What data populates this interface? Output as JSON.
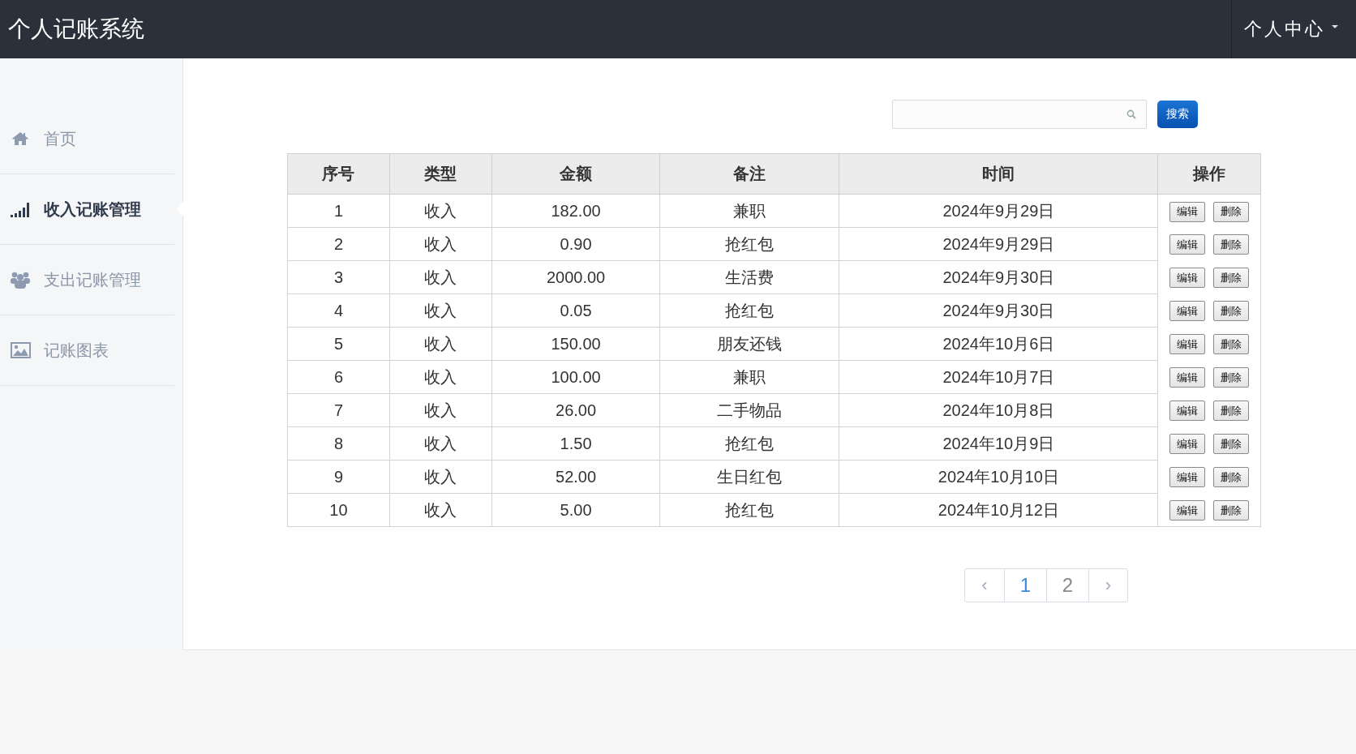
{
  "header": {
    "title": "个人记账系统",
    "user_menu": "个人中心"
  },
  "sidebar": {
    "items": [
      {
        "label": "首页",
        "selected": false
      },
      {
        "label": "收入记账管理",
        "selected": true
      },
      {
        "label": "支出记账管理",
        "selected": false
      },
      {
        "label": "记账图表",
        "selected": false
      }
    ]
  },
  "search": {
    "button": "搜索"
  },
  "table": {
    "columns": [
      "序号",
      "类型",
      "金额",
      "备注",
      "时间",
      "操作"
    ],
    "rows": [
      {
        "cells": [
          "1",
          "收入",
          "182.00",
          "兼职",
          "2024年9月29日"
        ],
        "actions": [
          "编辑",
          "删除"
        ]
      },
      {
        "cells": [
          "2",
          "收入",
          "0.90",
          "抢红包",
          "2024年9月29日"
        ],
        "actions": [
          "编辑",
          "删除"
        ]
      },
      {
        "cells": [
          "3",
          "收入",
          "2000.00",
          "生活费",
          "2024年9月30日"
        ],
        "actions": [
          "编辑",
          "删除"
        ]
      },
      {
        "cells": [
          "4",
          "收入",
          "0.05",
          "抢红包",
          "2024年9月30日"
        ],
        "actions": [
          "编辑",
          "删除"
        ]
      },
      {
        "cells": [
          "5",
          "收入",
          "150.00",
          "朋友还钱",
          "2024年10月6日"
        ],
        "actions": [
          "编辑",
          "删除"
        ]
      },
      {
        "cells": [
          "6",
          "收入",
          "100.00",
          "兼职",
          "2024年10月7日"
        ],
        "actions": [
          "编辑",
          "删除"
        ]
      },
      {
        "cells": [
          "7",
          "收入",
          "26.00",
          "二手物品",
          "2024年10月8日"
        ],
        "actions": [
          "编辑",
          "删除"
        ]
      },
      {
        "cells": [
          "8",
          "收入",
          "1.50",
          "抢红包",
          "2024年10月9日"
        ],
        "actions": [
          "编辑",
          "删除"
        ]
      },
      {
        "cells": [
          "9",
          "收入",
          "52.00",
          "生日红包",
          "2024年10月10日"
        ],
        "actions": [
          "编辑",
          "删除"
        ]
      },
      {
        "cells": [
          "10",
          "收入",
          "5.00",
          "抢红包",
          "2024年10月12日"
        ],
        "actions": [
          "编辑",
          "删除"
        ]
      }
    ]
  },
  "pagination": {
    "prev": "‹",
    "pages": [
      {
        "label": "1",
        "selected": true
      },
      {
        "label": "2",
        "selected": false
      }
    ],
    "next": "›"
  }
}
